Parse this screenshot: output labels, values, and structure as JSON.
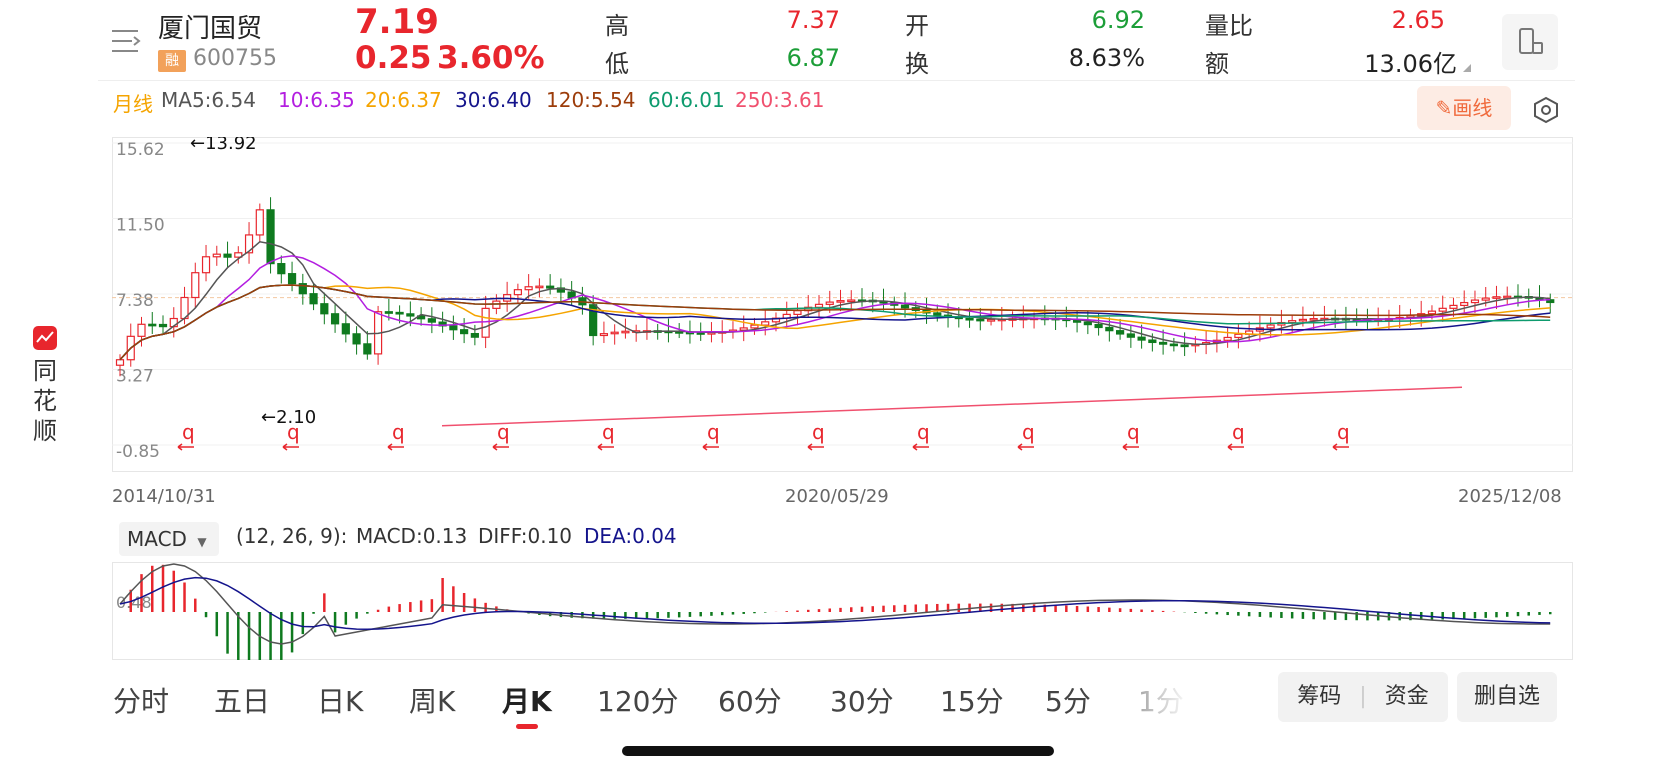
{
  "header": {
    "stock_name": "厦门国贸",
    "rong_badge": "融",
    "stock_code": "600755",
    "price": "7.19",
    "change": "0.25",
    "change_pct": "3.60%",
    "stats": [
      {
        "label": "高",
        "value": "7.37",
        "color": "#e8262d"
      },
      {
        "label": "开",
        "value": "6.92",
        "color": "#1c9e38"
      },
      {
        "label": "量比",
        "value": "2.65",
        "color": "#e8262d"
      },
      {
        "label": "低",
        "value": "6.87",
        "color": "#1c9e38"
      },
      {
        "label": "换",
        "value": "8.63%",
        "color": "#222222"
      },
      {
        "label": "额",
        "value": "13.06亿",
        "color": "#222222"
      }
    ]
  },
  "ma_bar": {
    "period": "月线",
    "ma5": "MA5:6.54",
    "ma10": "10:6.35",
    "ma20": "20:6.37",
    "ma30": "30:6.40",
    "ma120": "120:5.54",
    "ma60": "60:6.01",
    "ma250": "250:3.61",
    "draw_label": "画线"
  },
  "brand": {
    "name": "同花顺"
  },
  "chart_data": [
    {
      "type": "candlestick",
      "period": "monthly",
      "y_ticks": [
        "15.62",
        "11.50",
        "7.38",
        "3.27",
        "-0.85"
      ],
      "ylim": [
        -0.85,
        15.62
      ],
      "x_dates": [
        "2014/10/31",
        "2020/05/29",
        "2025/12/08"
      ],
      "annotations": {
        "high": "←13.92",
        "low": "←2.10"
      },
      "event_marker": "q",
      "event_marker_count": 12,
      "ma_colors": {
        "ma5": "#555555",
        "ma10": "#b31ee0",
        "ma20": "#f5a400",
        "ma30": "#14148c",
        "ma60": "#0e9b6e",
        "ma120": "#9c3c0a",
        "ma250": "#f0506e"
      }
    },
    {
      "type": "macd",
      "selector": "MACD",
      "params": "(12, 26, 9):",
      "macd": "MACD:0.13",
      "diff": "DIFF:0.10",
      "dea": "DEA:0.04",
      "y_tick": "0.48"
    }
  ],
  "tabs": [
    "分时",
    "五日",
    "日K",
    "周K",
    "月K",
    "120分",
    "60分",
    "30分",
    "15分",
    "5分",
    "1分"
  ],
  "active_tab": "月K",
  "buttons": {
    "chips": "筹码",
    "funds": "资金",
    "delete_fav": "删自选"
  }
}
